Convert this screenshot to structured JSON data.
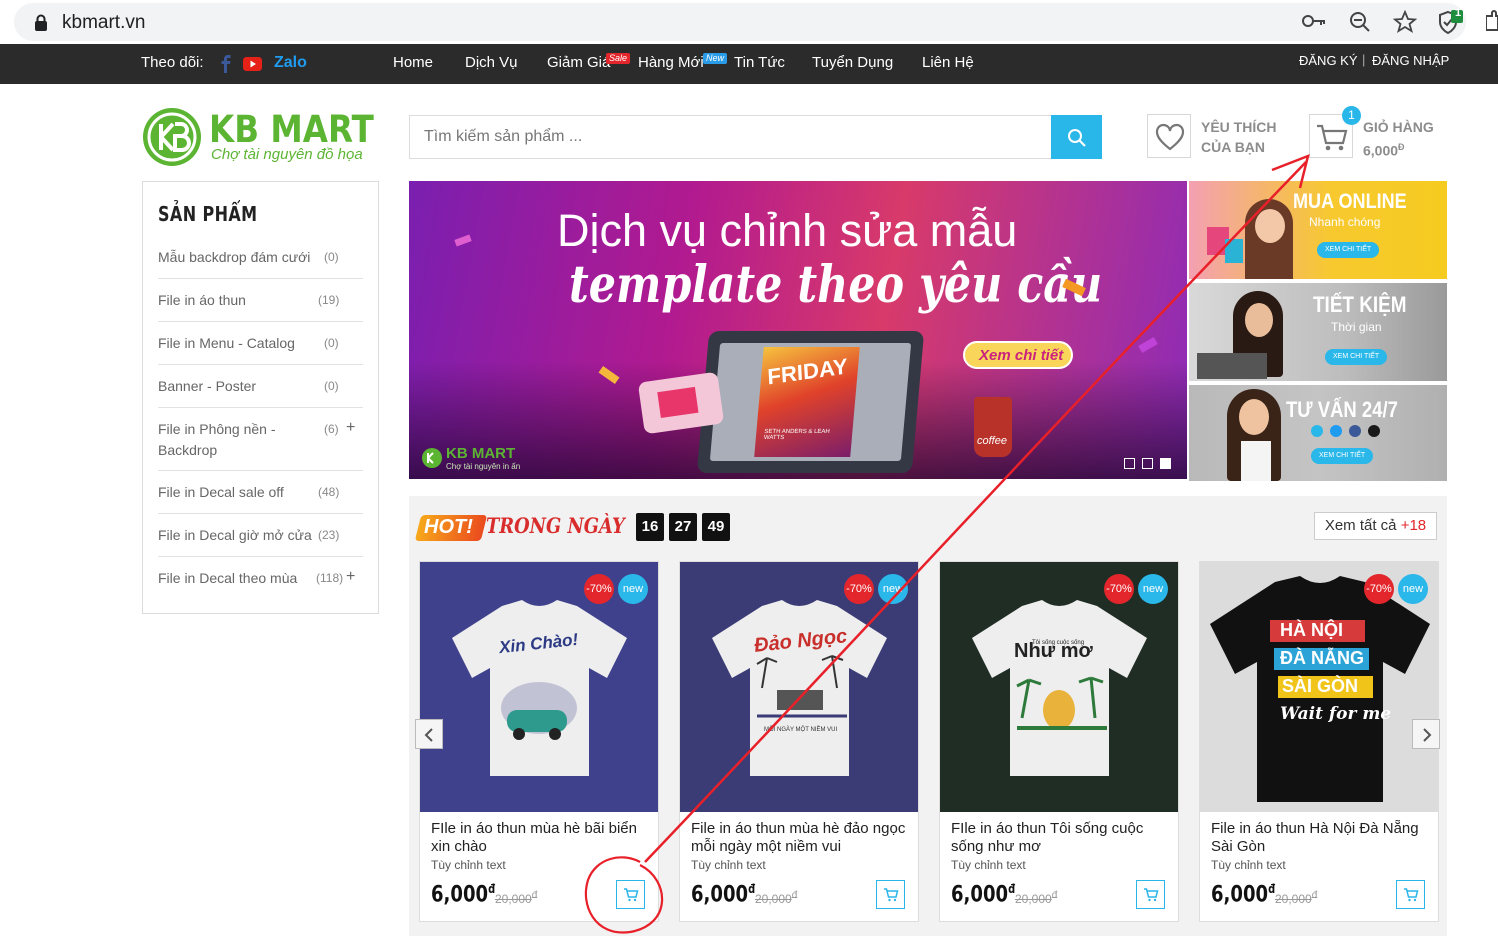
{
  "browser": {
    "url": "kbmart.vn",
    "extension_badge": "1"
  },
  "topnav": {
    "follow_label": "Theo dõi:",
    "zalo_label": "Zalo",
    "menu": [
      "Home",
      "Dịch Vụ",
      "Giảm Giá",
      "Hàng Mới",
      "Tin Tức",
      "Tuyển Dụng",
      "Liên Hệ"
    ],
    "sale_badge": "Sale",
    "new_badge": "New",
    "register": "ĐĂNG KÝ",
    "separator": "|",
    "login": "ĐĂNG NHẬP"
  },
  "header": {
    "logo_title": "KB MART",
    "logo_tagline": "Chợ tài nguyên đồ họa",
    "search_placeholder": "Tìm kiếm sản phẩm ...",
    "wishlist_line1": "YÊU THÍCH",
    "wishlist_line2": "CỦA BẠN",
    "cart_label": "GIỎ HÀNG",
    "cart_amount": "6,000",
    "cart_currency": "Đ",
    "cart_count": "1"
  },
  "sidebar": {
    "title": "SẢN PHẨM",
    "items": [
      {
        "label": "Mẫu backdrop đám cưới",
        "count": "(0)",
        "expand": ""
      },
      {
        "label": "File in áo thun",
        "count": "(19)",
        "expand": ""
      },
      {
        "label": "File in Menu - Catalog",
        "count": "(0)",
        "expand": ""
      },
      {
        "label": "Banner - Poster",
        "count": "(0)",
        "expand": ""
      },
      {
        "label": "File in Phông nền - Backdrop",
        "count": "(6)",
        "expand": "+"
      },
      {
        "label": "File in Decal sale off",
        "count": "(48)",
        "expand": ""
      },
      {
        "label": "File in Decal giờ mở cửa",
        "count": "(23)",
        "expand": ""
      },
      {
        "label": "File in Decal theo mùa",
        "count": "(118)",
        "expand": "+"
      }
    ]
  },
  "banner": {
    "line1": "Dịch vụ chỉnh sửa mẫu",
    "line2": "template theo yêu cầu",
    "cta": "Xem chi tiết",
    "poster_text": "FRIDAY",
    "poster_sub": "SETH ANDERS & LEAH WATTS",
    "cup_text": "coffee",
    "logo_text": "KB MART",
    "logo_tagline": "Chợ tài nguyên in ấn"
  },
  "side_ads": [
    {
      "title": "MUA ONLINE",
      "subtitle": "Nhanh chóng",
      "button": "XEM CHI TIẾT"
    },
    {
      "title": "TIẾT KIỆM",
      "subtitle": "Thời gian",
      "button": "XEM CHI TIẾT"
    },
    {
      "title": "TƯ VẤN 24/7",
      "subtitle": "",
      "button": "XEM CHI TIẾT"
    }
  ],
  "hot": {
    "hot_word": "HOT!",
    "title": "TRONG NGÀY",
    "timer": [
      "16",
      "27",
      "49"
    ],
    "view_all": "Xem tất cả",
    "view_all_count": "+18"
  },
  "products": [
    {
      "name": "FIle in áo thun mùa hè bãi biển xin chào",
      "sub": "Tùy chỉnh text",
      "price": "6,000",
      "old_price": "20,000",
      "discount": "-70%",
      "badge": "new",
      "shirt_text": "Xin Chào!"
    },
    {
      "name": "File in áo thun mùa hè đảo ngọc mỗi ngày một niềm vui",
      "sub": "Tùy chỉnh text",
      "price": "6,000",
      "old_price": "20,000",
      "discount": "-70%",
      "badge": "new",
      "shirt_text": "Đảo Ngọc",
      "shirt_sub": "MỖI NGÀY MỘT NIỀM VUI"
    },
    {
      "name": "FIle in áo thun Tôi sống cuộc sống như mơ",
      "sub": "Tùy chỉnh text",
      "price": "6,000",
      "old_price": "20,000",
      "discount": "-70%",
      "badge": "new",
      "shirt_text": "Như mơ",
      "shirt_sub": "Tôi sống cuộc sống"
    },
    {
      "name": "File in áo thun Hà Nội Đà Nẵng Sài Gòn",
      "sub": "Tùy chỉnh text",
      "price": "6,000",
      "old_price": "20,000",
      "discount": "-70%",
      "badge": "new",
      "shirt_lines": [
        "HÀ NỘI",
        "ĐÀ NẴNG",
        "SÀI GÒN",
        "Wait for me"
      ]
    }
  ],
  "currency_symbol": "đ",
  "colors": {
    "accent": "#29b6e8",
    "brand_green": "#5cb532",
    "sale_red": "#e3262c",
    "nav_bg": "#2b2b2b"
  }
}
